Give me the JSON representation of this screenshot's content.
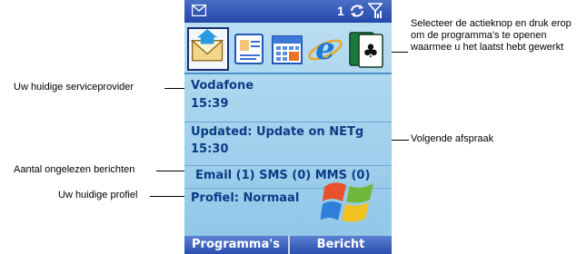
{
  "status_bar": {
    "unread_count": "1",
    "icons": [
      "envelope-icon",
      "sync-icon",
      "signal-strength-icon"
    ]
  },
  "app_icons": [
    {
      "name": "inbox-envelope-icon",
      "selected": true
    },
    {
      "name": "contacts-card-icon",
      "selected": false
    },
    {
      "name": "calendar-icon",
      "selected": false
    },
    {
      "name": "internet-explorer-icon",
      "selected": false
    },
    {
      "name": "solitaire-cards-icon",
      "selected": false
    }
  ],
  "home": {
    "operator": "Vodafone",
    "time": "15:39",
    "appointment_title": "Updated: Update on NETg",
    "appointment_time": "15:30",
    "messages": "Email (1) SMS (0) MMS (0)",
    "profile": "Profiel: Normaal"
  },
  "softkeys": {
    "left": "Programma's",
    "right": "Bericht"
  },
  "callouts": {
    "provider": "Uw huidige serviceprovider",
    "unread": "Aantal ongelezen berichten",
    "profile": "Uw huidige profiel",
    "action": "Selecteer de actieknop en druk erop om de programma's te openen waarmee u het laatst hebt gewerkt",
    "next_appointment": "Volgende afspraak"
  },
  "colors": {
    "title_bar": "#2448a8",
    "screen_background": "#a6d3ee",
    "text": "#0c3b86",
    "softkey_bar": "#2b4fae"
  }
}
